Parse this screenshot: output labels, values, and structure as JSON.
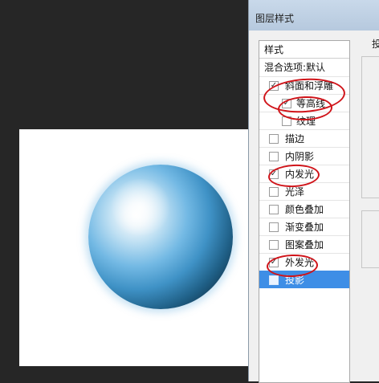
{
  "dialog": {
    "title": "图层样式",
    "right_panel_title_partial": "投"
  },
  "styles_panel": {
    "header": "样式",
    "blend_options": "混合选项:默认",
    "items": [
      {
        "label": "斜面和浮雕",
        "checked": true,
        "sub": false
      },
      {
        "label": "等高线",
        "checked": true,
        "sub": true
      },
      {
        "label": "纹理",
        "checked": false,
        "sub": true
      },
      {
        "label": "描边",
        "checked": false,
        "sub": false
      },
      {
        "label": "内阴影",
        "checked": false,
        "sub": false
      },
      {
        "label": "内发光",
        "checked": true,
        "sub": false
      },
      {
        "label": "光泽",
        "checked": false,
        "sub": false
      },
      {
        "label": "颜色叠加",
        "checked": false,
        "sub": false
      },
      {
        "label": "渐变叠加",
        "checked": false,
        "sub": false
      },
      {
        "label": "图案叠加",
        "checked": false,
        "sub": false
      },
      {
        "label": "外发光",
        "checked": true,
        "sub": false
      },
      {
        "label": "投影",
        "checked": false,
        "sub": false,
        "selected": true
      }
    ]
  },
  "colors": {
    "selection": "#3e8ee6",
    "annotation": "#d0141a",
    "sphere": "#3f92c6"
  }
}
